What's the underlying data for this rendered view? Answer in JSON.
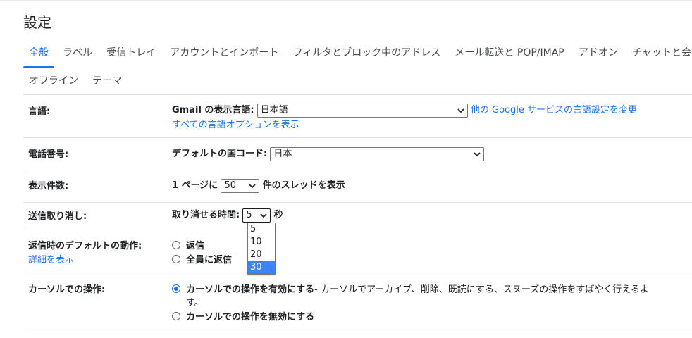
{
  "page_title": "設定",
  "tabs_row1": [
    {
      "label": "全般",
      "active": true
    },
    {
      "label": "ラベル"
    },
    {
      "label": "受信トレイ"
    },
    {
      "label": "アカウントとインポート"
    },
    {
      "label": "フィルタとブロック中のアドレス"
    },
    {
      "label": "メール転送と POP/IMAP"
    },
    {
      "label": "アドオン"
    },
    {
      "label": "チャットと会議"
    }
  ],
  "tabs_row2": [
    {
      "label": "オフライン"
    },
    {
      "label": "テーマ"
    }
  ],
  "language": {
    "label": "言語:",
    "display_label": "Gmail の表示言語:",
    "display_value": "日本語",
    "google_link": "他の Google サービスの言語設定を変更",
    "all_options_link": "すべての言語オプションを表示"
  },
  "phone": {
    "label": "電話番号:",
    "country_label": "デフォルトの国コード:",
    "country_value": "日本"
  },
  "page_size": {
    "label": "表示件数:",
    "prefix": "1 ページに",
    "value": "50",
    "suffix": "件のスレッドを表示"
  },
  "undo_send": {
    "label": "送信取り消し:",
    "time_label": "取り消せる時間:",
    "value": "5",
    "unit": "秒",
    "options": [
      "5",
      "10",
      "20",
      "30"
    ],
    "highlighted_option": "30"
  },
  "reply_default": {
    "label": "返信時のデフォルトの動作:",
    "details_link": "詳細を表示",
    "options": [
      "返信",
      "全員に返信"
    ]
  },
  "cursor_actions": {
    "label": "カーソルでの操作:",
    "enable_label": "カーソルでの操作を有効にする",
    "enable_desc": " - カーソルでアーカイブ、削除、既読にする、スヌーズの操作をすばやく行えるよ",
    "enable_desc_cont": "す。",
    "disable_label": "カーソルでの操作を無効にする"
  },
  "colors": {
    "accent": "#1a73e8",
    "dropdown_highlight": "#3b83f7",
    "divider": "#e0e0e0"
  }
}
